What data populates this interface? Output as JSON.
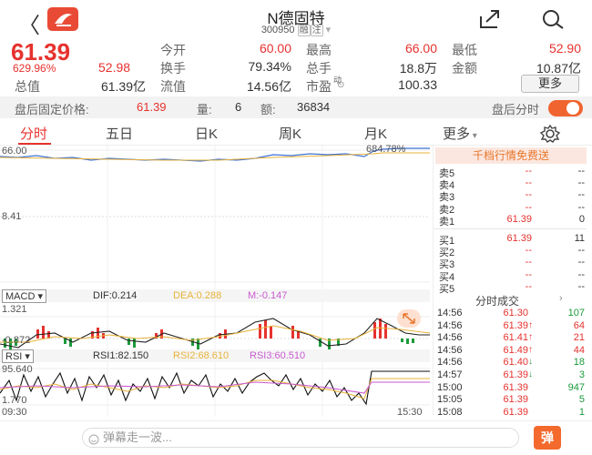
{
  "header": {
    "back_icon": "back-chevron-icon",
    "app_logo_icon": "app-logo-icon",
    "title": "N德固特",
    "code": "300950",
    "tags": [
      "融",
      "注"
    ],
    "share_icon": "share-icon",
    "search_icon": "search-icon"
  },
  "quote": {
    "price": "61.39",
    "change_pct": "629.96%",
    "low_value": "52.98",
    "colors": {
      "up": "#e6322e",
      "down": "#1c9a3a"
    }
  },
  "stats": {
    "open_label": "今开",
    "open": "60.00",
    "high_label": "最高",
    "high": "66.00",
    "low_label": "最低",
    "low": "52.90",
    "turnover_label": "换手",
    "turnover": "79.34%",
    "volume_label": "总手",
    "volume": "18.8万",
    "amount_label": "金额",
    "amount": "10.87亿",
    "mktcap_label": "总值",
    "mktcap": "61.39亿",
    "float_label": "流值",
    "float": "14.56亿",
    "pe_label": "市盈",
    "pe_sup": "动",
    "pe": "100.33",
    "more_label": "更多"
  },
  "after_hours": {
    "price_label": "盘后固定价格:",
    "price": "61.39",
    "vol_label": "量:",
    "vol": "6",
    "amt_label": "额:",
    "amt": "36834",
    "timeshare_label": "盘后分时",
    "toggle_on": true
  },
  "tabs": [
    {
      "label": "分时",
      "active": true
    },
    {
      "label": "五日"
    },
    {
      "label": "日K"
    },
    {
      "label": "周K"
    },
    {
      "label": "月K"
    },
    {
      "label": "更多"
    }
  ],
  "settings_icon": "gear-icon",
  "intraday": {
    "ymax_label": "66.00",
    "ymid_label": "8.41",
    "pct_label": "684.78%",
    "start_time": "09:30",
    "end_time": "15:30"
  },
  "macd": {
    "name": "MACD",
    "dif": "DIF:0.214",
    "dea": "DEA:0.288",
    "m": "M:-0.147",
    "top_label": "1.321",
    "bottom_label": "-0.872"
  },
  "rsi": {
    "name": "RSI",
    "rsi1": "RSI1:82.150",
    "rsi2": "RSI2:68.610",
    "rsi3": "RSI3:60.510",
    "top_label": "95.640",
    "bottom_label": "1.770"
  },
  "order_book": {
    "banner": "千档行情免费送",
    "asks": [
      {
        "label": "卖5",
        "price": "--",
        "vol": "--"
      },
      {
        "label": "卖4",
        "price": "--",
        "vol": "--"
      },
      {
        "label": "卖3",
        "price": "--",
        "vol": "--"
      },
      {
        "label": "卖2",
        "price": "--",
        "vol": "--"
      },
      {
        "label": "卖1",
        "price": "61.39",
        "vol": "0"
      }
    ],
    "bids": [
      {
        "label": "买1",
        "price": "61.39",
        "vol": "11"
      },
      {
        "label": "买2",
        "price": "--",
        "vol": "--"
      },
      {
        "label": "买3",
        "price": "--",
        "vol": "--"
      },
      {
        "label": "买4",
        "price": "--",
        "vol": "--"
      },
      {
        "label": "买5",
        "price": "--",
        "vol": "--"
      }
    ],
    "trades_title": "分时成交",
    "trades": [
      {
        "time": "14:56",
        "price": "61.30",
        "dir": "",
        "vol": "107"
      },
      {
        "time": "14:56",
        "price": "61.39",
        "dir": "↑",
        "vol": "64"
      },
      {
        "time": "14:56",
        "price": "61.41",
        "dir": "↑",
        "vol": "21"
      },
      {
        "time": "14:56",
        "price": "61.49",
        "dir": "↑",
        "vol": "44"
      },
      {
        "time": "14:56",
        "price": "61.40",
        "dir": "↓",
        "vol": "18"
      },
      {
        "time": "14:57",
        "price": "61.39",
        "dir": "↓",
        "vol": "3"
      },
      {
        "time": "15:00",
        "price": "61.39",
        "dir": "",
        "vol": "947"
      },
      {
        "time": "15:05",
        "price": "61.39",
        "dir": "",
        "vol": "5"
      },
      {
        "time": "15:08",
        "price": "61.39",
        "dir": "",
        "vol": "1"
      }
    ]
  },
  "bottom": {
    "danmaku_placeholder": "弹幕走一波...",
    "danmaku_btn": "弹"
  }
}
